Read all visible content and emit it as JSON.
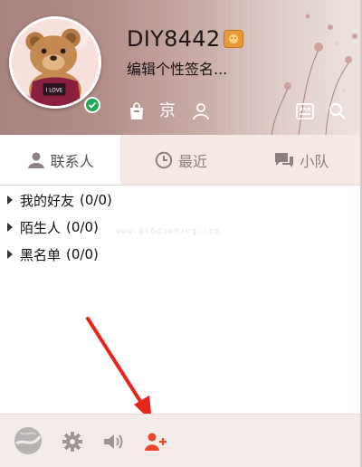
{
  "profile": {
    "nickname": "DIY8442",
    "signature": "编辑个性签名...",
    "location_label": "京",
    "status": "online"
  },
  "header_icons": [
    "bag-icon",
    "user-icon",
    "mail-icon",
    "search-icon"
  ],
  "tabs": [
    {
      "label": "联系人",
      "icon": "person-icon",
      "active": true
    },
    {
      "label": "最近",
      "icon": "clock-icon",
      "active": false
    },
    {
      "label": "小队",
      "icon": "chat-bubble-icon",
      "active": false
    }
  ],
  "groups": [
    {
      "name": "我的好友",
      "count": "(0/0)"
    },
    {
      "name": "陌生人",
      "count": "(0/0)"
    },
    {
      "name": "黑名单",
      "count": "(0/0)"
    }
  ],
  "watermark": "www.pc6downing.com",
  "toolbar": [
    "globe-icon",
    "gear-icon",
    "speaker-icon",
    "add-friend-icon"
  ],
  "colors": {
    "accent": "#e8472b",
    "online": "#23a654",
    "tab_bar": "#f6e8e3",
    "toolbar": "#f3ebe9"
  }
}
